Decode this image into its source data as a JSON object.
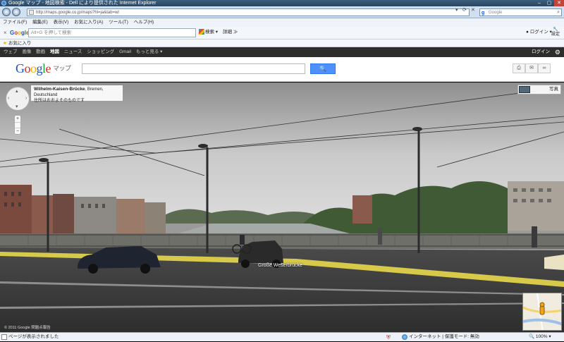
{
  "browser": {
    "title": "Google マップ - 地図検索 - Dell により提供された Internet Explorer",
    "url": "http://maps.google.co.jp/maps?hl=ja&tab=wl",
    "search_placeholder": "Google",
    "search_brand": "g",
    "menu": [
      "ファイル(F)",
      "編集(E)",
      "表示(V)",
      "お気に入り(A)",
      "ツール(T)",
      "ヘルプ(H)"
    ],
    "winbtns": [
      "–",
      "▢",
      "✕"
    ]
  },
  "toolbar": {
    "close": "×",
    "logo": "Google",
    "search_placeholder": "Alt+G を押して検索",
    "search_label": "検索",
    "detail_label": "詳細 ≫",
    "login_label": "ログイン",
    "settings_label": "設定"
  },
  "favorites": {
    "label": "お気に入り"
  },
  "gbar": {
    "items": [
      "ウェブ",
      "画像",
      "動画",
      "地図",
      "ニュース",
      "ショッピング",
      "Gmail",
      "もっと見る ▾"
    ],
    "active_index": 3,
    "login": "ログイン"
  },
  "maps": {
    "logo_parts": [
      "G",
      "o",
      "o",
      "g",
      "l",
      "e"
    ],
    "logo_suffix": "マップ",
    "search_value": "",
    "search_btn": "🔍"
  },
  "streetview": {
    "place_name": "Wilhelm-Kaisen-Brücke",
    "place_city": ", Bremen, Deutschland",
    "place_note": "住所はおおよそのものです",
    "photo_label": "写真",
    "street_label": "Große Weserbrücke",
    "copyright": "© 2011 Google   問題点報告"
  },
  "status": {
    "text": "ページが表示されました",
    "network": "インターネット | 保護モード: 無効",
    "zoom": "100%"
  },
  "colors": {
    "accent": "#4d90fe",
    "gbar": "#2d2d2d"
  }
}
